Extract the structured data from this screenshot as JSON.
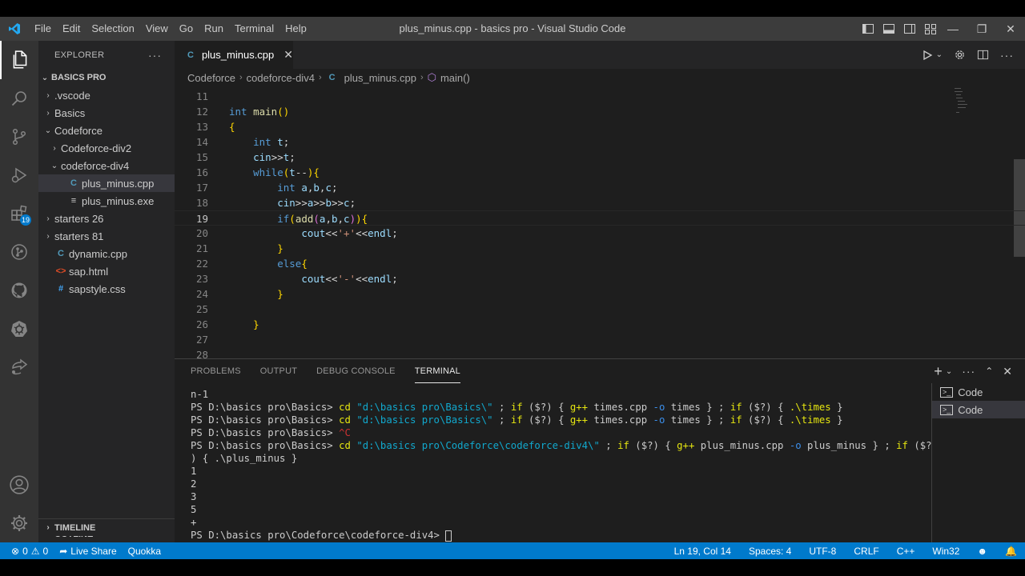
{
  "window": {
    "title": "plus_minus.cpp - basics pro - Visual Studio Code",
    "menu": [
      "File",
      "Edit",
      "Selection",
      "View",
      "Go",
      "Run",
      "Terminal",
      "Help"
    ]
  },
  "activity_bar": {
    "items": [
      "explorer",
      "search",
      "source-control",
      "run-debug",
      "extensions",
      "git-graph",
      "github",
      "kubernetes",
      "live-share"
    ],
    "extensions_badge": "19"
  },
  "sidebar": {
    "header": "EXPLORER",
    "root": "BASICS PRO",
    "tree": [
      {
        "label": ".vscode",
        "type": "folder",
        "expanded": false,
        "depth": 1
      },
      {
        "label": "Basics",
        "type": "folder",
        "expanded": false,
        "depth": 1
      },
      {
        "label": "Codeforce",
        "type": "folder",
        "expanded": true,
        "depth": 1
      },
      {
        "label": "Codeforce-div2",
        "type": "folder",
        "expanded": false,
        "depth": 2
      },
      {
        "label": "codeforce-div4",
        "type": "folder",
        "expanded": true,
        "depth": 2
      },
      {
        "label": "plus_minus.cpp",
        "type": "cpp",
        "depth": 3,
        "selected": true
      },
      {
        "label": "plus_minus.exe",
        "type": "exe",
        "depth": 3
      },
      {
        "label": "starters 26",
        "type": "folder",
        "expanded": false,
        "depth": 1
      },
      {
        "label": "starters 81",
        "type": "folder",
        "expanded": false,
        "depth": 1
      },
      {
        "label": "dynamic.cpp",
        "type": "cpp",
        "depth": 1
      },
      {
        "label": "sap.html",
        "type": "html",
        "depth": 1
      },
      {
        "label": "sapstyle.css",
        "type": "css",
        "depth": 1
      }
    ],
    "outline": "OUTLINE",
    "timeline": "TIMELINE"
  },
  "editor": {
    "tab_label": "plus_minus.cpp",
    "breadcrumb": [
      "Codeforce",
      "codeforce-div4",
      "plus_minus.cpp",
      "main()"
    ],
    "current_line": 19,
    "lines": [
      {
        "n": "11",
        "text": ""
      },
      {
        "n": "12",
        "text": "int main()"
      },
      {
        "n": "13",
        "text": "{"
      },
      {
        "n": "14",
        "text": "    int t;"
      },
      {
        "n": "15",
        "text": "    cin>>t;"
      },
      {
        "n": "16",
        "text": "    while(t--){"
      },
      {
        "n": "17",
        "text": "        int a,b,c;"
      },
      {
        "n": "18",
        "text": "        cin>>a>>b>>c;"
      },
      {
        "n": "19",
        "text": "        if(add(a,b,c)){"
      },
      {
        "n": "20",
        "text": "            cout<<'+'<<endl;"
      },
      {
        "n": "21",
        "text": "        }"
      },
      {
        "n": "22",
        "text": "        else{"
      },
      {
        "n": "23",
        "text": "            cout<<'-'<<endl;"
      },
      {
        "n": "24",
        "text": "        }"
      },
      {
        "n": "25",
        "text": ""
      },
      {
        "n": "26",
        "text": "    }"
      },
      {
        "n": "27",
        "text": ""
      },
      {
        "n": "28",
        "text": ""
      }
    ]
  },
  "panel": {
    "tabs": [
      "PROBLEMS",
      "OUTPUT",
      "DEBUG CONSOLE",
      "TERMINAL"
    ],
    "active_tab": "TERMINAL",
    "terminal_lines": [
      "n-1",
      "PS D:\\basics pro\\Basics> cd \"d:\\basics pro\\Basics\\\" ; if ($?) { g++ times.cpp -o times } ; if ($?) { .\\times }",
      "PS D:\\basics pro\\Basics> cd \"d:\\basics pro\\Basics\\\" ; if ($?) { g++ times.cpp -o times } ; if ($?) { .\\times }",
      "PS D:\\basics pro\\Basics> ^C",
      "PS D:\\basics pro\\Basics> cd \"d:\\basics pro\\Codeforce\\codeforce-div4\\\" ; if ($?) { g++ plus_minus.cpp -o plus_minus } ; if ($?",
      ") { .\\plus_minus }",
      "1",
      "2",
      "3",
      "5",
      "+",
      "PS D:\\basics pro\\Codeforce\\codeforce-div4> "
    ],
    "terminal_instances": [
      "Code",
      "Code"
    ]
  },
  "status_bar": {
    "errors": "0",
    "warnings": "0",
    "live_share": "Live Share",
    "quokka": "Quokka",
    "position": "Ln 19, Col 14",
    "spaces": "Spaces: 4",
    "encoding": "UTF-8",
    "eol": "CRLF",
    "language": "C++",
    "platform": "Win32"
  },
  "colors": {
    "accent": "#007acc",
    "editor_bg": "#1e1e1e",
    "sidebar_bg": "#252526",
    "activity_bg": "#333333",
    "titlebar_bg": "#3c3c3c"
  }
}
